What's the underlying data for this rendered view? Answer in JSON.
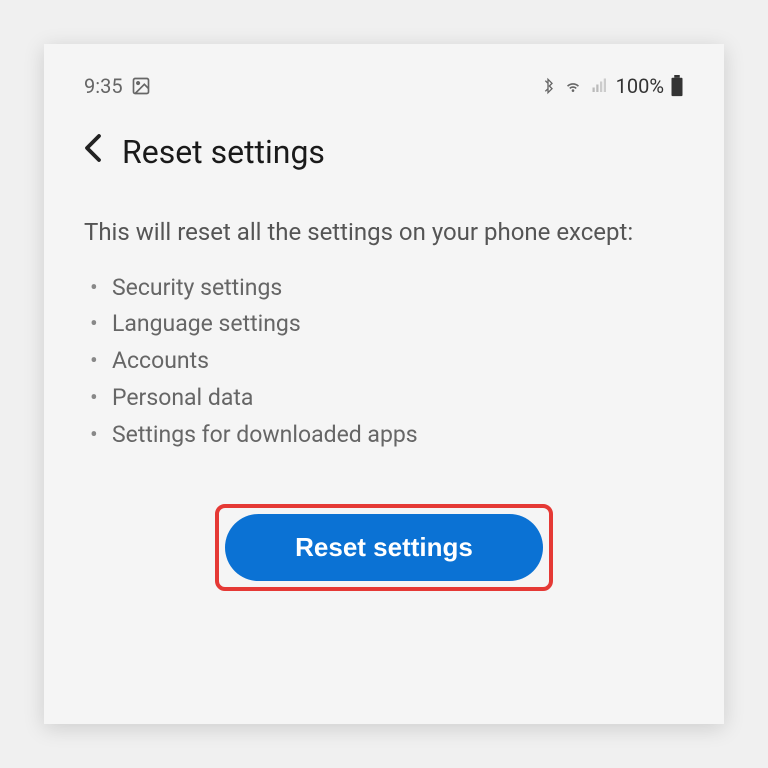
{
  "status_bar": {
    "time": "9:35",
    "battery_percent": "100%"
  },
  "header": {
    "title": "Reset settings"
  },
  "content": {
    "description": "This will reset all the settings on your phone except:",
    "exceptions": [
      "Security settings",
      "Language settings",
      "Accounts",
      "Personal data",
      "Settings for downloaded apps"
    ]
  },
  "action": {
    "button_label": "Reset settings"
  }
}
